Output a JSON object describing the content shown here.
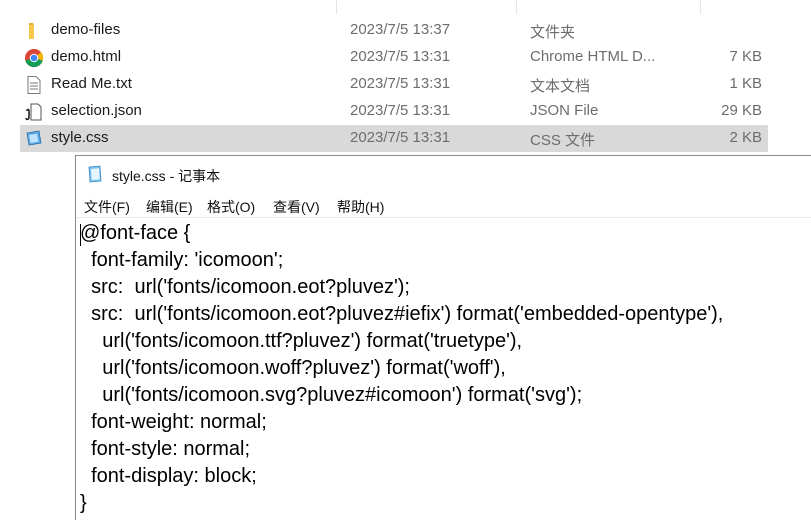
{
  "explorer": {
    "files": [
      {
        "name": "demo-files",
        "date": "2023/7/5 13:37",
        "type": "文件夹",
        "size": "",
        "icon": "folder-icon",
        "selected": false
      },
      {
        "name": "demo.html",
        "date": "2023/7/5 13:31",
        "type": "Chrome HTML D...",
        "size": "7 KB",
        "icon": "chrome-icon",
        "selected": false
      },
      {
        "name": "Read Me.txt",
        "date": "2023/7/5 13:31",
        "type": "文本文档",
        "size": "1 KB",
        "icon": "text-file-icon",
        "selected": false
      },
      {
        "name": "selection.json",
        "date": "2023/7/5 13:31",
        "type": "JSON File",
        "size": "29 KB",
        "icon": "json-file-icon",
        "selected": false
      },
      {
        "name": "style.css",
        "date": "2023/7/5 13:31",
        "type": "CSS 文件",
        "size": "2 KB",
        "icon": "css-file-icon",
        "selected": true
      }
    ]
  },
  "notepad": {
    "title": "style.css - 记事本",
    "icon": "notepad-icon",
    "menu": [
      "文件(F)",
      "编辑(E)",
      "格式(O)",
      "查看(V)",
      "帮助(H)"
    ],
    "lines": [
      "@font-face {",
      "  font-family: 'icomoon';",
      "  src:  url('fonts/icomoon.eot?pluvez');",
      "  src:  url('fonts/icomoon.eot?pluvez#iefix') format('embedded-opentype'),",
      "    url('fonts/icomoon.ttf?pluvez') format('truetype'),",
      "    url('fonts/icomoon.woff?pluvez') format('woff'),",
      "    url('fonts/icomoon.svg?pluvez#icomoon') format('svg');",
      "  font-weight: normal;",
      "  font-style: normal;",
      "  font-display: block;",
      "}"
    ]
  }
}
